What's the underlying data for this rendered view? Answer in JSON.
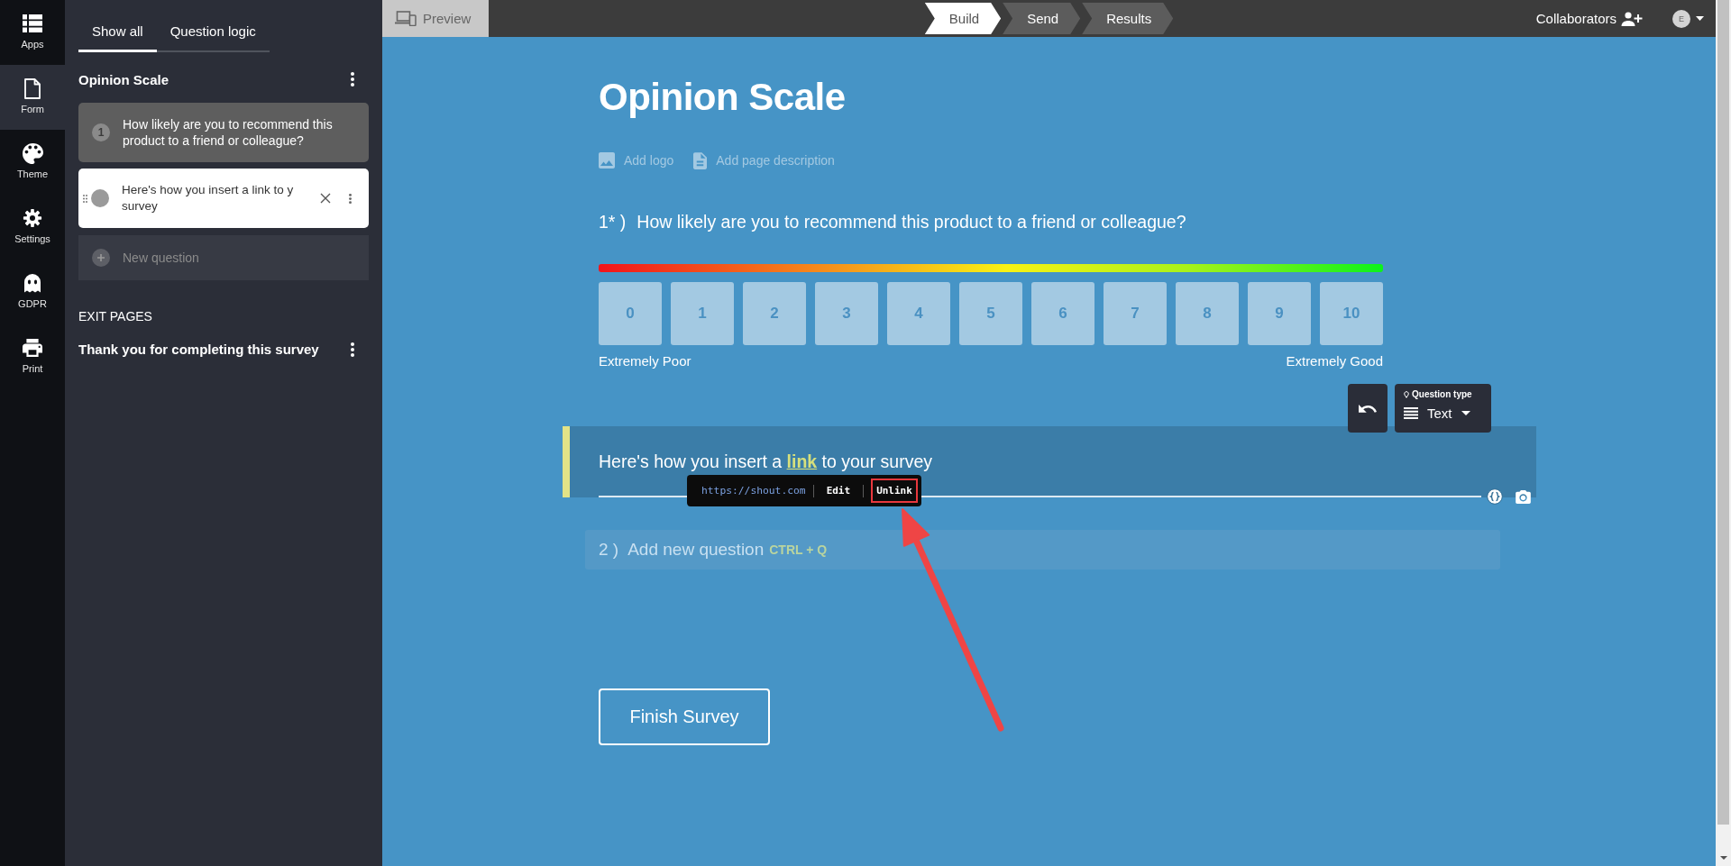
{
  "rail": {
    "items": [
      {
        "label": "Apps",
        "selected": false
      },
      {
        "label": "Form",
        "selected": true
      },
      {
        "label": "Theme",
        "selected": false
      },
      {
        "label": "Settings",
        "selected": false
      },
      {
        "label": "GDPR",
        "selected": false
      },
      {
        "label": "Print",
        "selected": false
      }
    ]
  },
  "sidebar": {
    "tabs": [
      {
        "label": "Show all",
        "selected": true
      },
      {
        "label": "Question logic",
        "selected": false
      }
    ],
    "form_title": "Opinion Scale",
    "questions": [
      {
        "number": "1",
        "text": "How likely are you to recommend this product to a friend or colleague?",
        "selected": false
      },
      {
        "text": "Here's how you insert a link to y\nsurvey",
        "selected": true
      }
    ],
    "new_question": "New question",
    "exit_pages": {
      "heading": "EXIT PAGES",
      "items": [
        {
          "title": "Thank you for completing this survey"
        }
      ]
    }
  },
  "top_bar": {
    "preview": "Preview",
    "steps": [
      {
        "label": "Build",
        "selected": true
      },
      {
        "label": "Send",
        "selected": false
      },
      {
        "label": "Results",
        "selected": false
      }
    ],
    "collaborators": "Collaborators",
    "avatar": "E"
  },
  "form": {
    "title": "Opinion Scale",
    "add_logo": "Add logo",
    "add_description": "Add page description",
    "questions": [
      {
        "kind": "scale",
        "number": "1* )",
        "text": "How likely are you to recommend this product to a friend or colleague?",
        "selected": false,
        "options": [
          "0",
          "1",
          "2",
          "3",
          "4",
          "5",
          "6",
          "7",
          "8",
          "9",
          "10"
        ],
        "low_label": "Extremely Poor",
        "high_label": "Extremely Good"
      },
      {
        "kind": "text",
        "text": "Here's how you insert a **link** to your survey",
        "selected": true,
        "link_popup": {
          "url": "https://shout.com",
          "actions": [
            {
              "label": "Edit",
              "highlighted": false
            },
            {
              "label": "Unlink",
              "highlighted": true
            }
          ]
        }
      }
    ],
    "toolbar": {
      "question_type_label": "Question type",
      "question_type": "Text"
    },
    "new_question": {
      "number": "2 )",
      "placeholder": "Add new question",
      "shortcut": "CTRL + Q"
    },
    "finish_button": "Finish Survey"
  }
}
